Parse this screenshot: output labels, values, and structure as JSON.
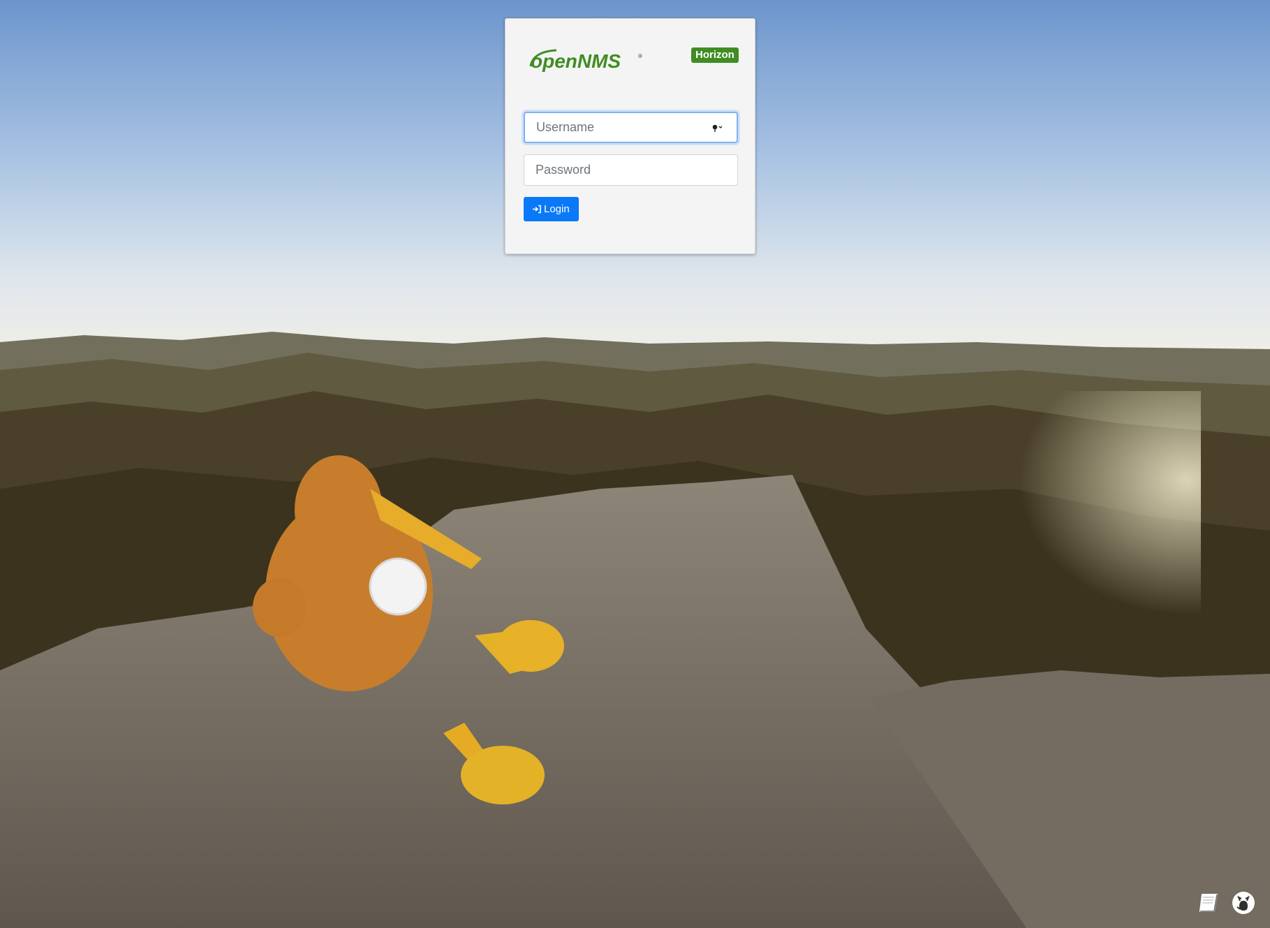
{
  "login": {
    "logo_text": "openNMS",
    "badge": "Horizon",
    "username_placeholder": "Username",
    "password_placeholder": "Password",
    "login_label": "Login"
  },
  "footer": {
    "docs_icon": "book-icon",
    "github_icon": "github-icon"
  },
  "colors": {
    "badge": "#3f8d22",
    "login_button": "#0a79f8",
    "logo_green": "#3f8d22"
  }
}
